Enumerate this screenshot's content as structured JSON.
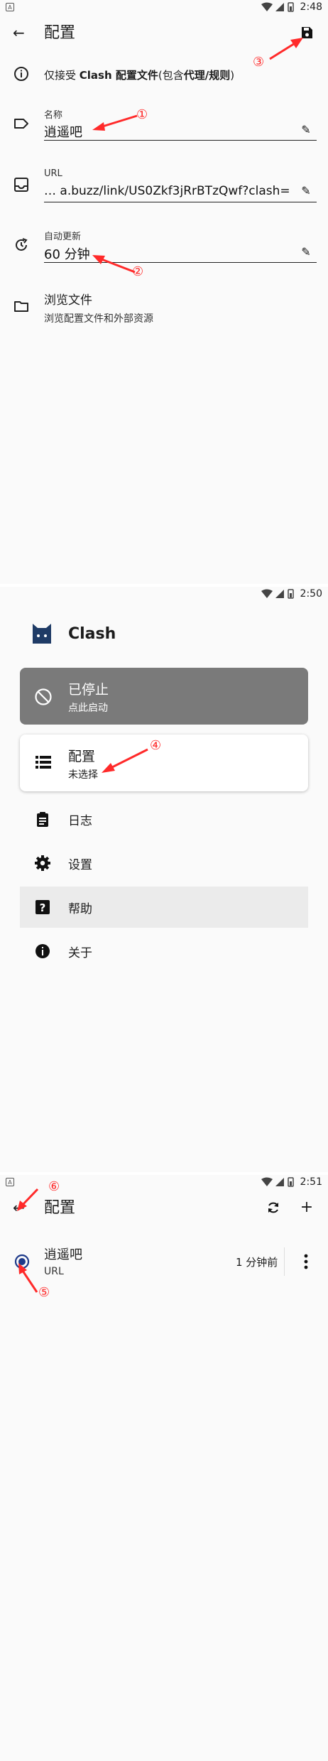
{
  "status_bar": {
    "time1": "2:48",
    "time2": "2:50",
    "time3": "2:51",
    "notification_glyph": "A"
  },
  "edit_screen": {
    "title": "配置",
    "info_prefix": "仅接受 ",
    "info_bold1": "Clash 配置文件",
    "info_mid": "(包含",
    "info_bold2": "代理/规则",
    "info_suffix": ")",
    "name_label": "名称",
    "name_value": "逍遥吧",
    "url_label": "URL",
    "url_value": "… a.buzz/link/US0Zkf3jRrBTzQwf?clash=",
    "update_label": "自动更新",
    "update_value": "60 分钟",
    "browse_title": "浏览文件",
    "browse_sub": "浏览配置文件和外部资源"
  },
  "home_screen": {
    "app_name": "Clash",
    "status_title": "已停止",
    "status_sub": "点此启动",
    "profile_title": "配置",
    "profile_sub": "未选择",
    "menu": [
      "日志",
      "设置",
      "帮助",
      "关于"
    ]
  },
  "profiles_screen": {
    "title": "配置",
    "profile_name": "逍遥吧",
    "profile_type": "URL",
    "updated": "1 分钟前"
  },
  "annotations": {
    "a1": "①",
    "a2": "②",
    "a3": "③",
    "a4": "④",
    "a5": "⑤",
    "a6": "⑥"
  },
  "colors": {
    "accent": "#ff2a2a",
    "status_card": "#7a7a7a",
    "help_highlight": "#ebebeb",
    "radio": "#1e3a8a"
  }
}
